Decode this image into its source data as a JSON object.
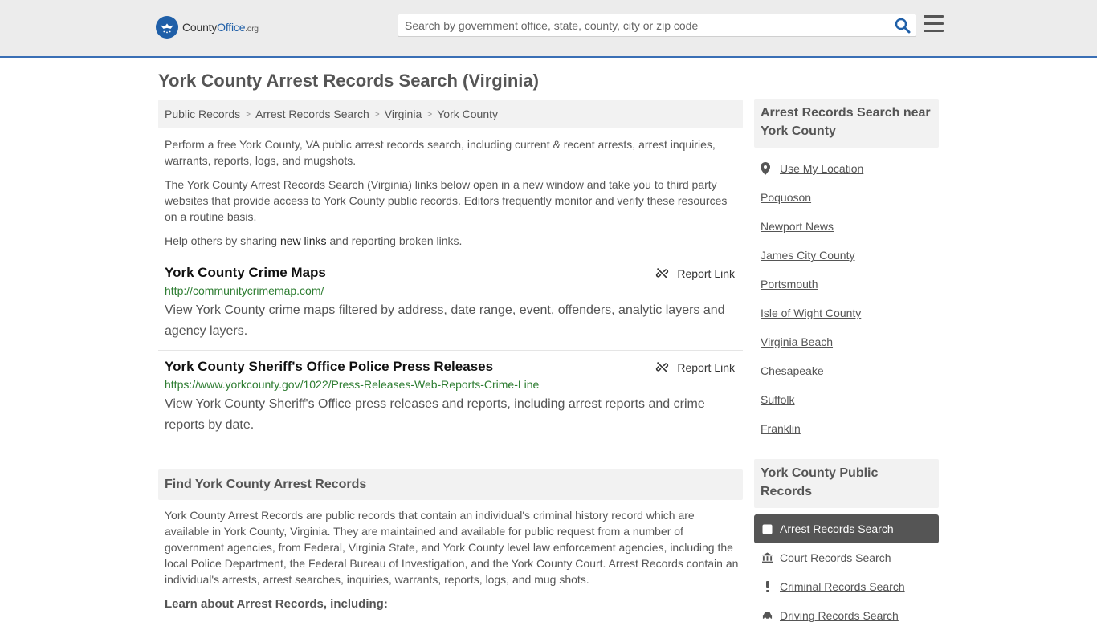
{
  "header": {
    "logo_main": "County",
    "logo_brand": "Office",
    "logo_tld": ".org",
    "search_placeholder": "Search by government office, state, county, city or zip code"
  },
  "page": {
    "title": "York County Arrest Records Search (Virginia)",
    "breadcrumb": [
      "Public Records",
      "Arrest Records Search",
      "Virginia",
      "York County"
    ],
    "intro_1": "Perform a free York County, VA public arrest records search, including current & recent arrests, arrest inquiries, warrants, reports, logs, and mugshots.",
    "intro_2": "The York County Arrest Records Search (Virginia) links below open in a new window and take you to third party websites that provide access to York County public records. Editors frequently monitor and verify these resources on a routine basis.",
    "intro_3_before": "Help others by sharing ",
    "intro_3_link": "new links",
    "intro_3_after": " and reporting broken links."
  },
  "links": [
    {
      "title": "York County Crime Maps",
      "report_label": "Report Link",
      "url": "http://communitycrimemap.com/",
      "description": "View York County crime maps filtered by address, date range, event, offenders, analytic layers and agency layers."
    },
    {
      "title": "York County Sheriff's Office Police Press Releases",
      "report_label": "Report Link",
      "url": "https://www.yorkcounty.gov/1022/Press-Releases-Web-Reports-Crime-Line",
      "description": "View York County Sheriff's Office press releases and reports, including arrest reports and crime reports by date."
    }
  ],
  "find_section": {
    "heading": "Find York County Arrest Records",
    "body": "York County Arrest Records are public records that contain an individual's criminal history record which are available in York County, Virginia. They are maintained and available for public request from a number of government agencies, from Federal, Virginia State, and York County level law enforcement agencies, including the local Police Department, the Federal Bureau of Investigation, and the York County Court. Arrest Records contain an individual's arrests, arrest searches, inquiries, warrants, reports, logs, and mug shots.",
    "learn_label": "Learn about Arrest Records, including:"
  },
  "sidebar": {
    "nearby_heading": "Arrest Records Search near York County",
    "use_location": "Use My Location",
    "nearby": [
      "Poquoson",
      "Newport News",
      "James City County",
      "Portsmouth",
      "Isle of Wight County",
      "Virginia Beach",
      "Chesapeake",
      "Suffolk",
      "Franklin"
    ],
    "public_heading": "York County Public Records",
    "public_records": [
      {
        "label": "Arrest Records Search",
        "icon": "square-icon"
      },
      {
        "label": "Court Records Search",
        "icon": "courthouse-icon"
      },
      {
        "label": "Criminal Records Search",
        "icon": "exclamation-icon"
      },
      {
        "label": "Driving Records Search",
        "icon": "car-icon"
      }
    ]
  },
  "colors": {
    "accent": "#3a6fb5",
    "link_green": "#2e7d32",
    "active_bg": "#555555"
  }
}
